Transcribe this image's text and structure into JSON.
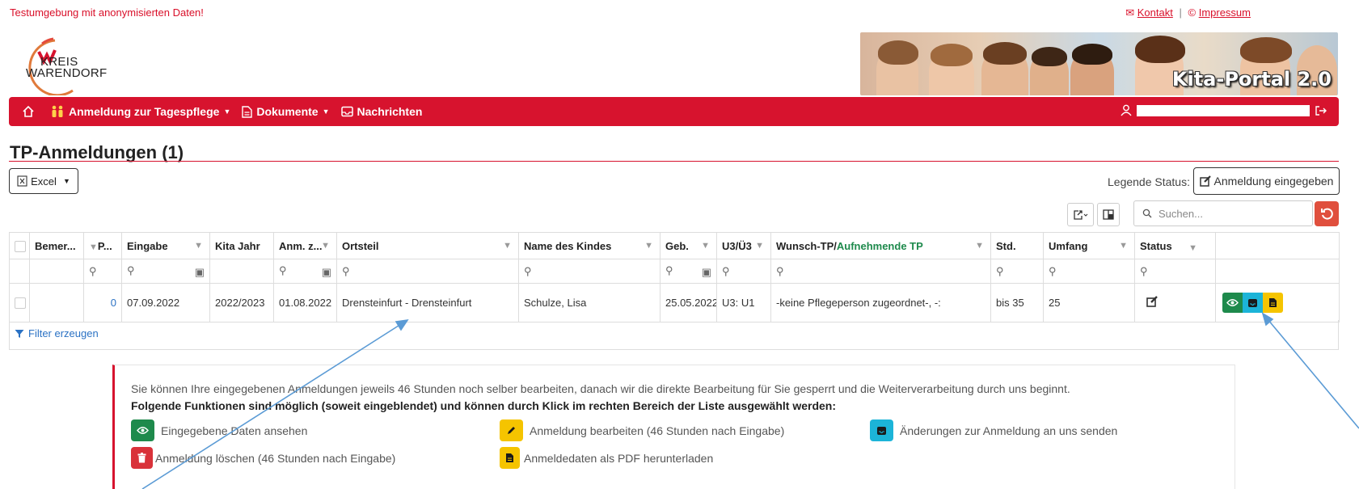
{
  "top_notice": "Testumgebung mit anonymisierten Daten!",
  "top_links": {
    "contact": "Kontakt",
    "separator": "|",
    "impressum": "Impressum"
  },
  "logo": {
    "line1": "KREIS",
    "line2": "WARENDORF"
  },
  "banner": {
    "title": "Kita-Portal 2.0"
  },
  "nav": {
    "home_icon": "home-icon",
    "items": [
      {
        "label": "Anmeldung zur Tagespflege",
        "icon": "people-icon",
        "dropdown": true
      },
      {
        "label": "Dokumente",
        "icon": "document-icon",
        "dropdown": true
      },
      {
        "label": "Nachrichten",
        "icon": "inbox-icon",
        "dropdown": false
      }
    ],
    "user_icon": "user-icon",
    "logout_icon": "logout-icon"
  },
  "page_title": "TP-Anmeldungen (1)",
  "toolbar": {
    "excel_label": "Excel",
    "legend_label": "Legende Status:",
    "legend_button": "Anmeldung eingegeben",
    "search_placeholder": "Suchen..."
  },
  "table": {
    "headers": [
      "",
      "Bemer...",
      "P...",
      "Eingabe",
      "Kita Jahr",
      "Anm. z...",
      "Ortsteil",
      "Name des Kindes",
      "Geb.",
      "U3/Ü3",
      "Wunsch-TP/",
      "Std.",
      "Umfang",
      "Status",
      ""
    ],
    "header_green_suffix": "Aufnehmende TP",
    "rows": [
      {
        "p": "0",
        "eingabe": "07.09.2022",
        "kita_jahr": "2022/2023",
        "anm_z": "01.08.2022",
        "ortsteil": "Drensteinfurt - Drensteinfurt",
        "name": "Schulze, Lisa",
        "geb": "25.05.2022",
        "u3": "U3: U1",
        "wunsch": "-keine Pflegeperson zugeordnet-, -:",
        "std": "bis 35",
        "umfang": "25"
      }
    ],
    "filter_link": "Filter erzeugen"
  },
  "info": {
    "line1": "Sie können Ihre eingegebenen Anmeldungen jeweils 46 Stunden noch selber bearbeiten, danach wir die direkte Bearbeitung für Sie gesperrt und die Weiterverarbeitung durch uns beginnt.",
    "line2": "Folgende Funktionen sind möglich (soweit eingeblendet) und können durch Klick im rechten Bereich der Liste ausgewählt werden:",
    "items": [
      {
        "label": "Eingegebene Daten ansehen",
        "color": "#1e8a4c",
        "icon": "eye-icon"
      },
      {
        "label": "Anmeldung bearbeiten (46 Stunden nach Eingabe)",
        "color": "#f5c400",
        "icon": "pencil-icon"
      },
      {
        "label": "Änderungen zur Anmeldung an uns senden",
        "color": "#1cb4d8",
        "icon": "send-inbox-icon"
      },
      {
        "label": "Anmeldung löschen (46 Stunden nach Eingabe)",
        "color": "#d9323a",
        "icon": "trash-icon"
      },
      {
        "label": "Anmeldedaten als PDF herunterladen",
        "color": "#f5c400",
        "icon": "pdf-icon"
      }
    ]
  },
  "colors": {
    "brand_red": "#d7132e",
    "green": "#1e8a4c",
    "cyan": "#1cb4d8",
    "yellow": "#f5c400",
    "link_blue": "#2b72c4"
  }
}
